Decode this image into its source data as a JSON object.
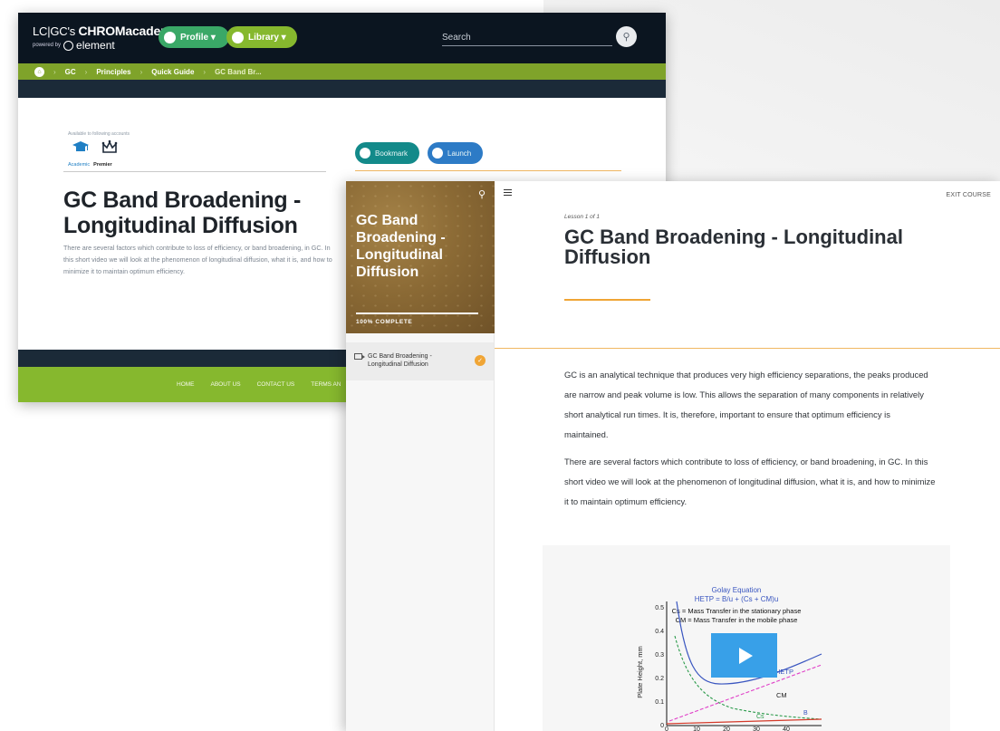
{
  "back": {
    "logo": {
      "prefix": "LC|GC's",
      "brand": "CHROMacademy",
      "powered": "powered by",
      "partner": "element"
    },
    "nav": {
      "profile": "Profile ▾",
      "library": "Library  ▾"
    },
    "search_placeholder": "Search",
    "breadcrumb": [
      "GC",
      "Principles",
      "Quick Guide",
      "GC Band Br..."
    ],
    "accounts": {
      "available": "Available to following accounts",
      "academic": "Academic",
      "premier": "Premier"
    },
    "actions": {
      "bookmark": "Bookmark",
      "launch": "Launch"
    },
    "title": "GC Band Broadening - Longitudinal Diffusion",
    "description": "There are several factors which contribute to loss of efficiency, or band broadening, in GC. In this short video we will look at the phenomenon of longitudinal diffusion, what it is, and how to minimize it to maintain optimum efficiency.",
    "footer": [
      "HOME",
      "ABOUT US",
      "CONTACT US",
      "TERMS AN"
    ]
  },
  "course": {
    "sidebar_title": "GC Band Broadening - Longitudinal Diffusion",
    "progress": "100% COMPLETE",
    "progress_fraction": 1.0,
    "lesson_item": "GC Band Broadening - Longitudinal Diffusion",
    "exit": "EXIT COURSE",
    "lesson_of": "Lesson 1 of 1",
    "title": "GC Band Broadening - Longitudinal Diffusion",
    "para1": "GC is an analytical technique that produces very high efficiency separations, the peaks produced are narrow and peak volume is low. This allows the separation of many components in relatively short analytical run times. It is, therefore, important to ensure that optimum efficiency is maintained.",
    "para2": "There are several factors which contribute to loss of efficiency, or band broadening, in GC. In this short video we will look at the phenomenon of longitudinal diffusion, what it is, and how to minimize it to maintain optimum efficiency."
  },
  "video_chart": {
    "title": "Golay Equation",
    "equation": "HETP = B/u   +  (Cs + CM)u",
    "legend1": "Cs = Mass Transfer in the stationary phase",
    "legend2": "CM = Mass Transfer in the mobile phase",
    "ylabel": "Plate Height, mm",
    "yticks": [
      "0",
      "0.1",
      "0.2",
      "0.3",
      "0.4",
      "0.5"
    ],
    "xticks": [
      "0",
      "10",
      "20",
      "30",
      "40"
    ],
    "labels": {
      "hetp": "HETP",
      "cm": "CM",
      "cs": "Cs",
      "b": "B"
    }
  },
  "colors": {
    "dark": "#0b1520",
    "green": "#86b82e",
    "orange": "#f0a535",
    "play": "#38a0e8"
  }
}
